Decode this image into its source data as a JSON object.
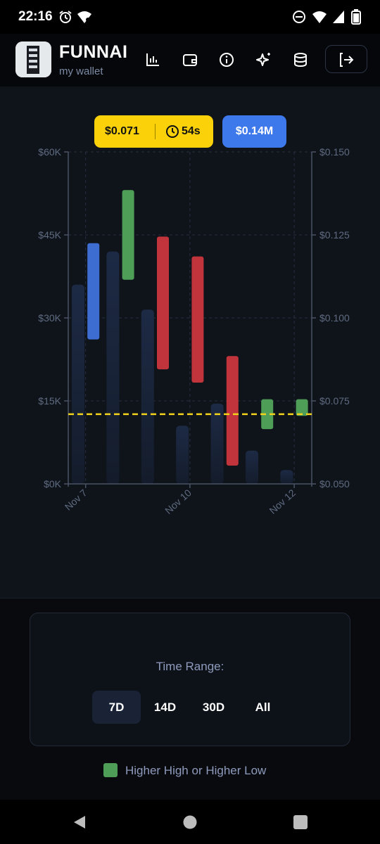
{
  "status_bar": {
    "time": "22:16",
    "left_icons": [
      "alarm-icon",
      "wifi-icon"
    ],
    "right_icons": [
      "do-not-disturb-icon",
      "wifi-icon",
      "signal-icon",
      "battery-icon"
    ]
  },
  "header": {
    "title": "FUNNAI",
    "subtitle": "my wallet",
    "icons": [
      "bar-chart-icon",
      "wallet-icon",
      "info-icon",
      "sparkles-icon",
      "database-icon"
    ],
    "logout_icon": "logout-icon"
  },
  "price_badge": {
    "price": "$0.071",
    "timer": "54s"
  },
  "market_cap_badge": {
    "value": "$0.14M"
  },
  "chart_data": {
    "type": "bar",
    "x_ticks": [
      "Nov 7",
      "Nov 10",
      "Nov 12"
    ],
    "y_left": {
      "ticks": [
        "$0K",
        "$15K",
        "$30K",
        "$45K",
        "$60K"
      ],
      "range": [
        0,
        60000
      ]
    },
    "y_right": {
      "ticks": [
        "$0.050",
        "$0.075",
        "$0.100",
        "$0.125",
        "$0.150"
      ],
      "range": [
        0.05,
        0.15
      ]
    },
    "volume_bars": [
      {
        "day": 0,
        "value": 36000
      },
      {
        "day": 1,
        "value": 42000
      },
      {
        "day": 2,
        "value": 31500
      },
      {
        "day": 3,
        "value": 10500
      },
      {
        "day": 4,
        "value": 14500
      },
      {
        "day": 5,
        "value": 6000
      },
      {
        "day": 6,
        "value": 2500
      }
    ],
    "price_ranges": [
      {
        "day": 0.5,
        "low": 0.0935,
        "high": 0.1225,
        "color": "#3d6dd1"
      },
      {
        "day": 1.5,
        "low": 0.1115,
        "high": 0.1385,
        "color": "#4f9e58"
      },
      {
        "day": 2.5,
        "low": 0.0845,
        "high": 0.1245,
        "color": "#c1343b"
      },
      {
        "day": 3.5,
        "low": 0.0805,
        "high": 0.1185,
        "color": "#c1343b"
      },
      {
        "day": 4.5,
        "low": 0.0555,
        "high": 0.0885,
        "color": "#c1343b"
      },
      {
        "day": 5.5,
        "low": 0.0665,
        "high": 0.0755,
        "color": "#4f9e58"
      },
      {
        "day": 6.5,
        "low": 0.0705,
        "high": 0.0755,
        "color": "#4f9e58"
      }
    ],
    "current_price_line": 0.071,
    "grid": true
  },
  "range_selector": {
    "label": "Time Range:",
    "options": [
      "7D",
      "14D",
      "30D",
      "All"
    ],
    "selected": "7D"
  },
  "legend": {
    "label": "Higher High or Higher Low",
    "color": "#4f9e58"
  },
  "nav_bar": {
    "icons": [
      "back-icon",
      "home-icon",
      "recents-icon"
    ]
  }
}
